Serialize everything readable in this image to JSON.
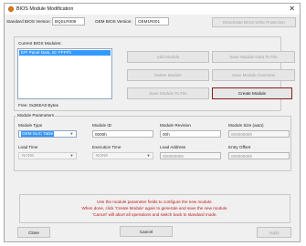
{
  "window": {
    "title": "BIOS Module Modification"
  },
  "versions": {
    "standard_label": "Standard BIOS Version:",
    "standard_value": "BQSLR009",
    "oem_label": "OEM BIOS Version:",
    "oem_value": "OEM1R001",
    "deactivate_button": "Deactivate BIOS Write Protection"
  },
  "modules": {
    "list_label": "Current BIOS Modules:",
    "items": [
      "EPI Panel Data, ID: FFFFh"
    ],
    "free_text": "Free: 0x2EEA0 Bytes"
  },
  "buttons": {
    "add_module": "Add Module",
    "save_to_file": "Save Module Data To File",
    "delete_module": "Delete Module",
    "save_overview": "Save Module Overview",
    "save_module_to_file": "Save Module To File",
    "create_module": "Create Module",
    "close": "Close",
    "cancel": "Cancel",
    "apply": "Apply"
  },
  "params": {
    "legend": "Module Parameters",
    "module_type_label": "Module Type",
    "module_type_value": "OEM SLIC Table",
    "module_id_label": "Module ID",
    "module_id_value": "0000h",
    "module_revision_label": "Module Revision",
    "module_revision_value": "00h",
    "module_size_label": "Module Size (auto)",
    "module_size_value": "00000000h",
    "load_time_label": "Load Time",
    "load_time_value": "NONE",
    "execution_time_label": "Execution Time",
    "execution_time_value": "NONE",
    "load_address_label": "Load Address",
    "load_address_value": "00000000h",
    "entry_offset_label": "Entry Offset",
    "entry_offset_value": "00000000h"
  },
  "message": {
    "lines": [
      "Use the module parameter fields to configure the new module.",
      "When done, click 'Create Module' again to generate and save the new module.",
      "'Cancel' will abort all operations and switch back to standard mode."
    ]
  },
  "icons": {
    "app": "bios-app-icon",
    "close": "close-icon",
    "caret": "chevron-down-icon"
  },
  "colors": {
    "message_text": "#c01818",
    "selection": "#3399ff",
    "primary_border": "#8b1a1a"
  }
}
